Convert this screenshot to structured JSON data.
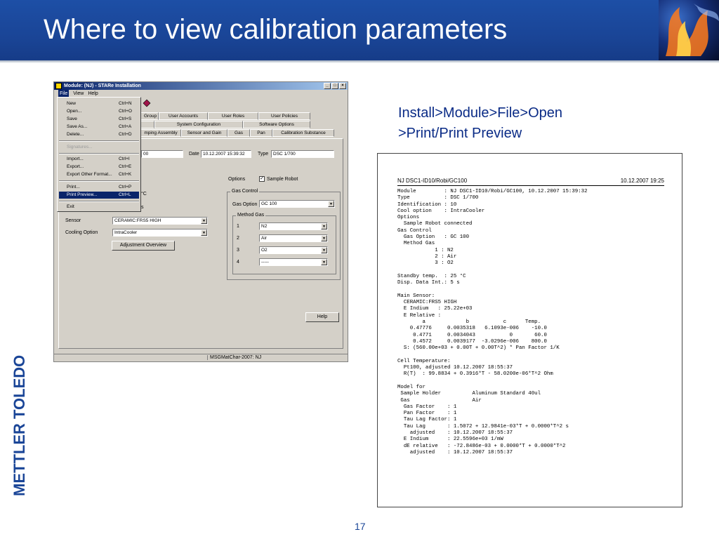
{
  "slide": {
    "title": "Where to view calibration parameters",
    "note_line1": "Install>Module>File>Open",
    "note_line2": ">Print/Print Preview",
    "page_number": "17",
    "logo_text": "METTLER TOLEDO",
    "accent_color": "#1a4597"
  },
  "window": {
    "title": "Module:  (NJ) - STARe Installation",
    "menu": [
      "File",
      "View",
      "Help"
    ],
    "tabs_row1": [
      "Group",
      "User Accounts",
      "User Roles",
      "User Policies"
    ],
    "tabs_row2": [
      "System Configuration",
      "Software Options"
    ],
    "tabs_row3": [
      "mping Assembly",
      "Sensor and Gain",
      "Gas",
      "Pan",
      "Calibration Substance"
    ],
    "id_value": "00",
    "date_label": "Date",
    "date_value": "10.12.2007 15:39:32",
    "type_label": "Type",
    "type_value": "DSC 1/700",
    "options_label": "Options",
    "sample_robot_label": "Sample Robot",
    "temp_fragment": "°C",
    "s_fragment": "s",
    "gas_control_label": "Gas Control",
    "gas_option_label": "Gas Option",
    "gas_option_value": "GC 100",
    "method_gas_label": "Method Gas",
    "method_gas": [
      {
        "n": "1",
        "v": "N2"
      },
      {
        "n": "2",
        "v": "Air"
      },
      {
        "n": "3",
        "v": "O2"
      },
      {
        "n": "4",
        "v": "-----"
      }
    ],
    "sensor_label": "Sensor",
    "sensor_value": "CERAMIC:FRS5 HIGH",
    "cooling_label": "Cooling Option",
    "cooling_value": "IntraCooler",
    "adjustment_button": "Adjustment Overview",
    "help_button": "Help",
    "status_text": "MSGMatChar-2007: NJ"
  },
  "file_menu": {
    "items": [
      {
        "label": "New",
        "shortcut": "Ctrl+N"
      },
      {
        "label": "Open...",
        "shortcut": "Ctrl+O"
      },
      {
        "label": "Save",
        "shortcut": "Ctrl+S"
      },
      {
        "label": "Save As...",
        "shortcut": "Ctrl+A"
      },
      {
        "label": "Delete...",
        "shortcut": "Ctrl+D"
      },
      {
        "label": "Signatures...",
        "shortcut": ""
      },
      {
        "label": "Import...",
        "shortcut": "Ctrl+I"
      },
      {
        "label": "Export...",
        "shortcut": "Ctrl+E"
      },
      {
        "label": "Export Other Format...",
        "shortcut": "Ctrl+K"
      },
      {
        "label": "Print...",
        "shortcut": "Ctrl+P"
      },
      {
        "label": "Print Preview...",
        "shortcut": "Ctrl+L"
      },
      {
        "label": "Exit",
        "shortcut": ""
      }
    ]
  },
  "preview": {
    "header_left": "NJ DSC1-ID10/Robi/GC100",
    "header_right": "10.12.2007 19:25",
    "lines": [
      "Module         : NJ DSC1-ID10/Robi/GC100, 10.12.2007 15:39:32",
      "Type           : DSC 1/700",
      "Identification : 10",
      "Cool option    : IntraCooler",
      "Options",
      "  Sample Robot connected",
      "Gas Control",
      "  Gas Option   : GC 100",
      "  Method Gas",
      "            1 : N2",
      "            2 : Air",
      "            3 : O2",
      "",
      "Standby temp.  : 25 °C",
      "Disp. Data Int.: 5 s",
      "",
      "Main Sensor:",
      "  CERAMIC:FRS5 HIGH",
      "  E Indium   : 25.22e+03",
      "  E Relative :",
      "        a             b           c      Temp.",
      "    0.47776     0.0035318   6.1093e-006    -10.0",
      "     0.4771     0.0034043           0       60.0",
      "     0.4572     0.0039177  -3.0296e-006    800.0",
      "  S: (560.00e+03 + 0.00T + 0.00T^2) * Pan Factor 1/K",
      "",
      "Cell Temperature:",
      "  Pt100, adjusted 10.12.2007 18:55:37",
      "  R(T)  : 99.8834 + 0.3916*T - 58.0200e-06*T^2 Ohm",
      "",
      "Model for",
      " Sample Holder          Aluminum Standard 40ul",
      " Gas                    Air",
      "  Gas Factor    : 1",
      "  Pan Factor    : 1",
      "  Tau Lag Factor: 1",
      "  Tau Lag       : 1.5072 + 12.9841e-03*T + 0.0000*T^2 s",
      "    adjusted    : 10.12.2007 18:55:37",
      "  E Indium      : 22.5596e+03 1/mW",
      "  dE relative   : -72.8486e-03 + 0.0000*T + 0.0000*T^2",
      "    adjusted    : 10.12.2007 18:55:37"
    ]
  }
}
